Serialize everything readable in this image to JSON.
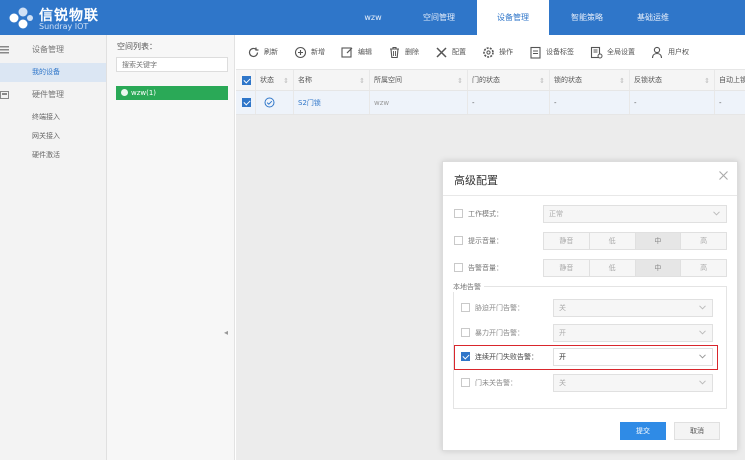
{
  "brand": {
    "name": "信锐物联",
    "sub": "Sundray IOT"
  },
  "topnav": [
    {
      "label": "wzw",
      "active": false
    },
    {
      "label": "空间管理",
      "active": false
    },
    {
      "label": "设备管理",
      "active": true
    },
    {
      "label": "智能策略",
      "active": false
    },
    {
      "label": "基础运维",
      "active": false
    }
  ],
  "sidebar": {
    "device_group": "设备管理",
    "my_devices": "我的设备",
    "hardware_group": "硬件管理",
    "items": [
      "终端接入",
      "网关接入",
      "硬件激活"
    ]
  },
  "space": {
    "title": "空间列表：",
    "search_placeholder": "搜索关键字",
    "node": "wzw(1)"
  },
  "toolbar": {
    "refresh": "刷新",
    "add": "新增",
    "edit": "编辑",
    "delete": "删除",
    "config": "配置",
    "operate": "操作",
    "device_tag": "设备标签",
    "global_settings": "全局设置",
    "user_perm": "用户权"
  },
  "table": {
    "headers": [
      "状态",
      "名称",
      "所属空间",
      "门的状态",
      "锁的状态",
      "反锁状态",
      "自动上锁"
    ],
    "row": {
      "name": "S2门锁",
      "space": "wzw",
      "door": "-",
      "lock": "-",
      "deadlock": "-",
      "auto": "-"
    }
  },
  "modal": {
    "title": "高级配置",
    "work_mode": {
      "label": "工作模式：",
      "value": "正常"
    },
    "prompt_volume": {
      "label": "提示音量：",
      "options": [
        "静音",
        "低",
        "中",
        "高"
      ],
      "selected": "中"
    },
    "alarm_volume": {
      "label": "告警音量：",
      "options": [
        "静音",
        "低",
        "中",
        "高"
      ],
      "selected": "中"
    },
    "local_alarm": {
      "legend": "本地告警",
      "duress": {
        "label": "胁迫开门告警：",
        "value": "关"
      },
      "force": {
        "label": "暴力开门告警：",
        "value": "开"
      },
      "fail": {
        "label": "连续开门失败告警：",
        "value": "开"
      },
      "unclosed": {
        "label": "门未关告警：",
        "value": "关"
      }
    },
    "submit": "提交",
    "cancel": "取消"
  },
  "colors": {
    "brand_blue": "#2f76c9",
    "green": "#2aa957",
    "highlight_red": "#d9262c",
    "primary_button": "#2f8be6"
  }
}
